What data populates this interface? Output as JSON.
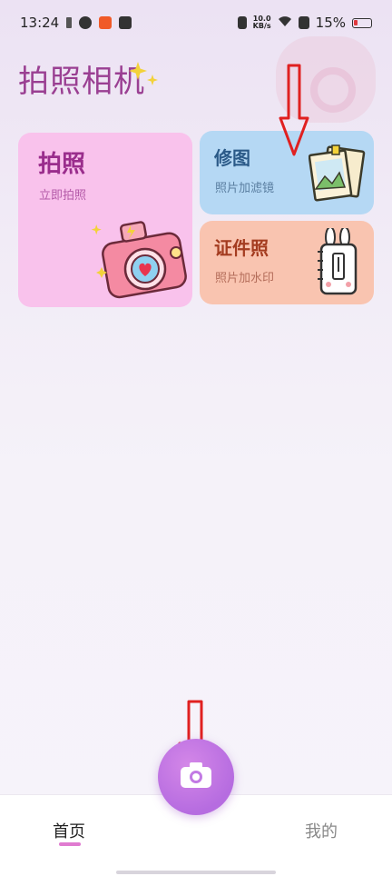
{
  "status_bar": {
    "time": "13:24",
    "net_speed_value": "10.0",
    "net_speed_unit": "KB/s",
    "battery": "15%"
  },
  "app": {
    "title": "拍照相机"
  },
  "cards": {
    "photo": {
      "title": "拍照",
      "subtitle": "立即拍照"
    },
    "edit": {
      "title": "修图",
      "subtitle": "照片加滤镜"
    },
    "id_photo": {
      "title": "证件照",
      "subtitle": "照片加水印"
    }
  },
  "bottom_nav": {
    "home_label": "首页",
    "mine_label": "我的"
  },
  "icons": {
    "sparkle": "sparkle-icon",
    "camera": "camera-icon",
    "photos": "photo-frames-icon",
    "notebook": "bunny-notebook-icon",
    "annotation_arrow": "down-arrow-icon"
  },
  "colors": {
    "title": "#9a3f92",
    "photo_card": "#f9c2ec",
    "edit_card": "#b5d8f4",
    "id_card": "#f9c4b0",
    "fab": "#b66ce0",
    "annotation_arrow": "#e02020"
  }
}
